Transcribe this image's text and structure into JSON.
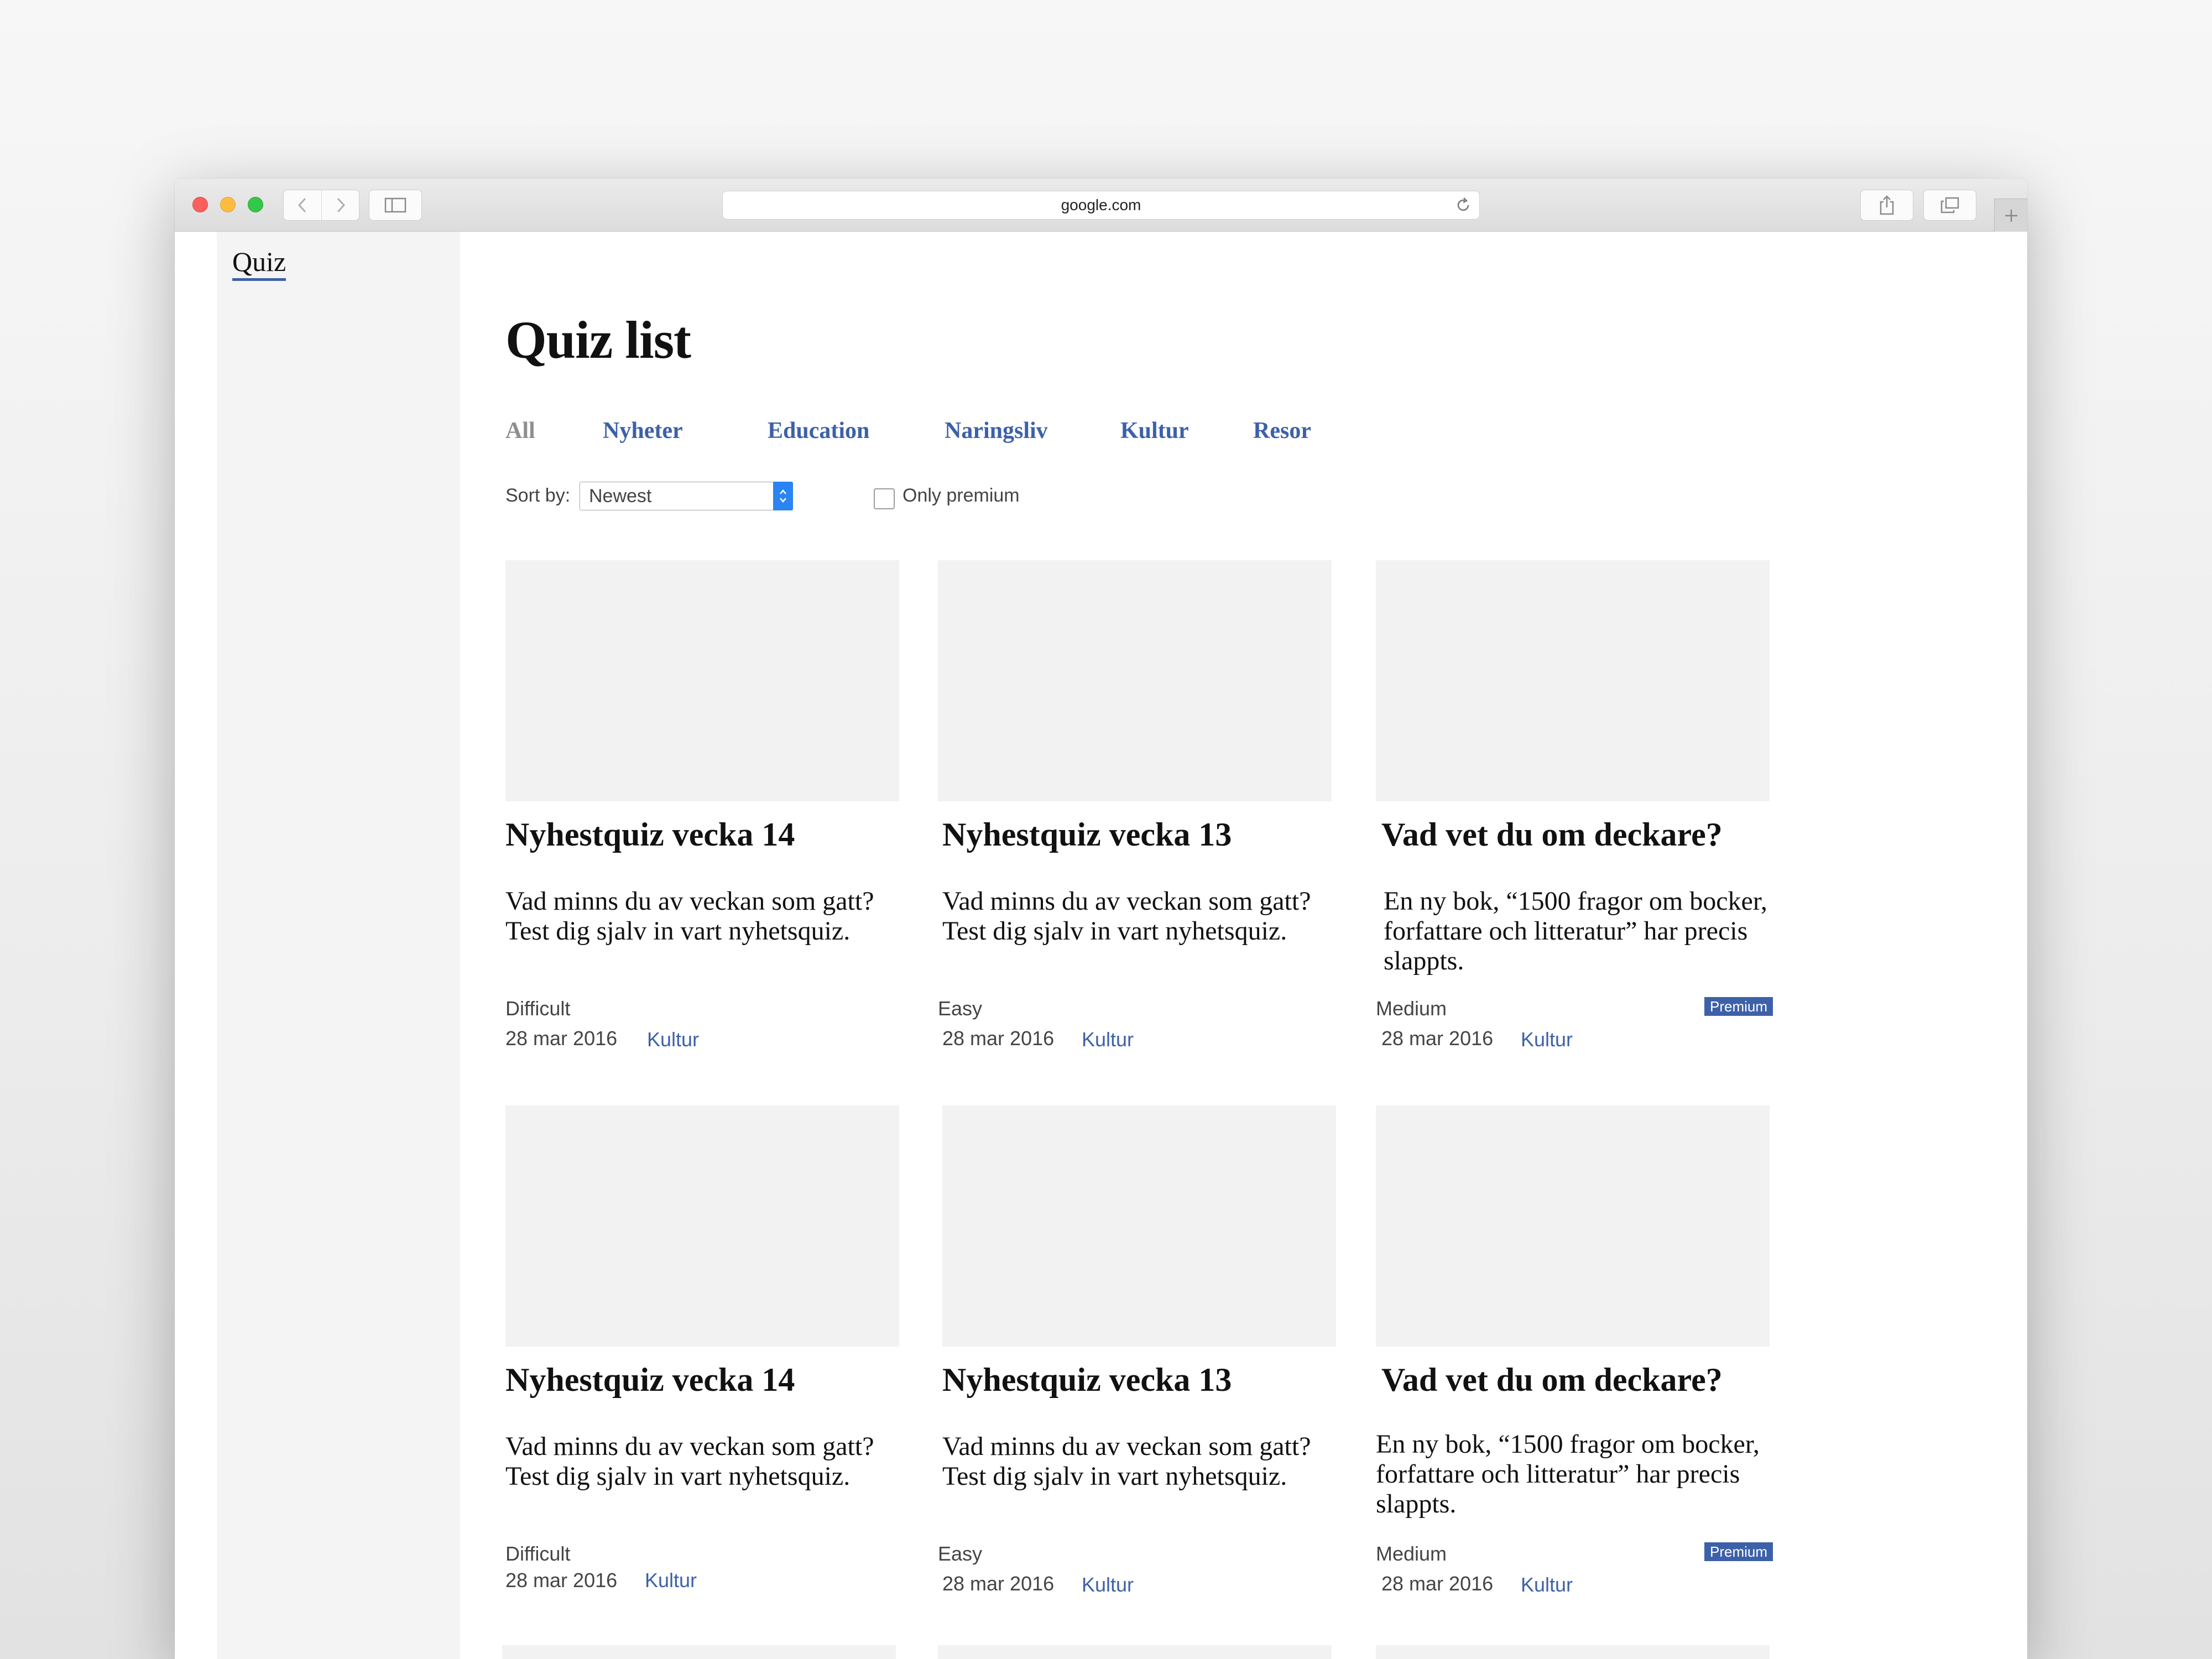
{
  "browser": {
    "url": "google.com"
  },
  "app": {
    "logo": "Quiz"
  },
  "page": {
    "title": "Quiz list"
  },
  "filters": [
    "All",
    "Nyheter",
    "Education",
    "Naringsliv",
    "Kultur",
    "Resor"
  ],
  "sort": {
    "label": "Sort by:",
    "value": "Newest"
  },
  "premium_filter": {
    "label": "Only premium",
    "checked": false
  },
  "cards": [
    {
      "title": "Nyhestquiz vecka 14",
      "description": "Vad minns du av veckan som gatt? Test dig sjalv in vart nyhetsquiz.",
      "difficulty": "Difficult",
      "date": "28 mar 2016",
      "category": "Kultur",
      "premium": ""
    },
    {
      "title": "Nyhestquiz vecka 13",
      "description": "Vad minns du av veckan som gatt? Test dig sjalv in vart nyhetsquiz.",
      "difficulty": "Easy",
      "date": "28 mar 2016",
      "category": "Kultur",
      "premium": ""
    },
    {
      "title": "Vad vet du om deckare?",
      "description": "En ny bok, “1500 fragor om bocker, forfattare och litteratur” har precis slappts.",
      "difficulty": "Medium",
      "date": "28 mar 2016",
      "category": "Kultur",
      "premium": "Premium"
    },
    {
      "title": "Nyhestquiz vecka 14",
      "description": "Vad minns du av veckan som gatt? Test dig sjalv in vart nyhetsquiz.",
      "difficulty": "Difficult",
      "date": "28 mar 2016",
      "category": "Kultur",
      "premium": ""
    },
    {
      "title": "Nyhestquiz vecka 13",
      "description": "Vad minns du av veckan som gatt? Test dig sjalv in vart nyhetsquiz.",
      "difficulty": "Easy",
      "date": "28 mar 2016",
      "category": "Kultur",
      "premium": ""
    },
    {
      "title": "Vad vet du om deckare?",
      "description": "En ny bok, “1500 fragor om bocker, forfattare och litteratur” har precis slappts.",
      "difficulty": "Medium",
      "date": "28 mar 2016",
      "category": "Kultur",
      "premium": "Premium"
    }
  ],
  "colors": {
    "accent": "#3d61a8",
    "inactive_filter": "#8e8e8e",
    "placeholder": "#f2f2f2"
  },
  "icons": {
    "back": "chevron-left-icon",
    "forward": "chevron-right-icon",
    "sidebar": "sidebar-icon",
    "reload": "reload-icon",
    "share": "share-icon",
    "tabs": "tabs-icon",
    "new_tab": "plus-icon"
  }
}
